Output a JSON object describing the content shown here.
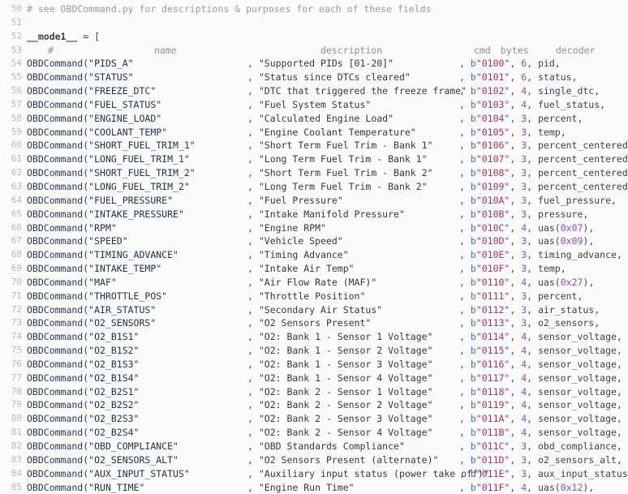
{
  "editor": {
    "background_color": "#fbfbfb",
    "gutter_color": "#b9b9b9",
    "first_line_number": 50,
    "last_line_number": 85,
    "accent_colors": {
      "byte_prefix": "#3b6fd4",
      "byte_string": "#a8345a",
      "number": "#8a4fbf",
      "identifier": "#3d4349",
      "function": "#2b3a55",
      "comment": "#9b9b9b"
    }
  },
  "lines": [
    {
      "number": "50",
      "kind": "comment",
      "comment": "# see OBDCommand.py for descriptions & purposes for each of these fields"
    },
    {
      "number": "51",
      "kind": "blank"
    },
    {
      "number": "52",
      "kind": "assignment",
      "var": "__mode1__",
      "op": "=",
      "bracket": "["
    },
    {
      "number": "53",
      "kind": "header",
      "hash": "#",
      "name": "name",
      "description": "description",
      "cmd": "cmd",
      "bytes": "bytes",
      "decoder": "decoder"
    },
    {
      "number": "54",
      "kind": "entry",
      "fn": "OBDCommand(",
      "name": "\"PIDS_A\"",
      "description": "\"Supported PIDs [01-20]\"",
      "byte_prefix": "b",
      "cmd": "\"0100\"",
      "bytes": "6",
      "decoder": "pid,"
    },
    {
      "number": "55",
      "kind": "entry",
      "fn": "OBDCommand(",
      "name": "\"STATUS\"",
      "description": "\"Status since DTCs cleared\"",
      "byte_prefix": "b",
      "cmd": "\"0101\"",
      "bytes": "6",
      "decoder": "status,"
    },
    {
      "number": "56",
      "kind": "entry",
      "fn": "OBDCommand(",
      "name": "\"FREEZE_DTC\"",
      "description": "\"DTC that triggered the freeze frame\"",
      "byte_prefix": "b",
      "cmd": "\"0102\"",
      "bytes": "4",
      "decoder": "single_dtc,"
    },
    {
      "number": "57",
      "kind": "entry",
      "fn": "OBDCommand(",
      "name": "\"FUEL_STATUS\"",
      "description": "\"Fuel System Status\"",
      "byte_prefix": "b",
      "cmd": "\"0103\"",
      "bytes": "4",
      "decoder": "fuel_status,"
    },
    {
      "number": "58",
      "kind": "entry",
      "fn": "OBDCommand(",
      "name": "\"ENGINE_LOAD\"",
      "description": "\"Calculated Engine Load\"",
      "byte_prefix": "b",
      "cmd": "\"0104\"",
      "bytes": "3",
      "decoder": "percent,"
    },
    {
      "number": "59",
      "kind": "entry",
      "fn": "OBDCommand(",
      "name": "\"COOLANT_TEMP\"",
      "description": "\"Engine Coolant Temperature\"",
      "byte_prefix": "b",
      "cmd": "\"0105\"",
      "bytes": "3",
      "decoder": "temp,"
    },
    {
      "number": "60",
      "kind": "entry",
      "fn": "OBDCommand(",
      "name": "\"SHORT_FUEL_TRIM_1\"",
      "description": "\"Short Term Fuel Trim - Bank 1\"",
      "byte_prefix": "b",
      "cmd": "\"0106\"",
      "bytes": "3",
      "decoder": "percent_centered,"
    },
    {
      "number": "61",
      "kind": "entry",
      "fn": "OBDCommand(",
      "name": "\"LONG_FUEL_TRIM_1\"",
      "description": "\"Long Term Fuel Trim - Bank 1\"",
      "byte_prefix": "b",
      "cmd": "\"0107\"",
      "bytes": "3",
      "decoder": "percent_centered,"
    },
    {
      "number": "62",
      "kind": "entry",
      "fn": "OBDCommand(",
      "name": "\"SHORT_FUEL_TRIM_2\"",
      "description": "\"Short Term Fuel Trim - Bank 2\"",
      "byte_prefix": "b",
      "cmd": "\"0108\"",
      "bytes": "3",
      "decoder": "percent_centered,"
    },
    {
      "number": "63",
      "kind": "entry",
      "fn": "OBDCommand(",
      "name": "\"LONG_FUEL_TRIM_2\"",
      "description": "\"Long Term Fuel Trim - Bank 2\"",
      "byte_prefix": "b",
      "cmd": "\"0109\"",
      "bytes": "3",
      "decoder": "percent_centered,"
    },
    {
      "number": "64",
      "kind": "entry",
      "fn": "OBDCommand(",
      "name": "\"FUEL_PRESSURE\"",
      "description": "\"Fuel Pressure\"",
      "byte_prefix": "b",
      "cmd": "\"010A\"",
      "bytes": "3",
      "decoder": "fuel_pressure,"
    },
    {
      "number": "65",
      "kind": "entry",
      "fn": "OBDCommand(",
      "name": "\"INTAKE_PRESSURE\"",
      "description": "\"Intake Manifold Pressure\"",
      "byte_prefix": "b",
      "cmd": "\"010B\"",
      "bytes": "3",
      "decoder": "pressure,"
    },
    {
      "number": "66",
      "kind": "entry",
      "fn": "OBDCommand(",
      "name": "\"RPM\"",
      "description": "\"Engine RPM\"",
      "byte_prefix": "b",
      "cmd": "\"010C\"",
      "bytes": "4",
      "decoder": "uas(0x07),",
      "decoder_hex": "0x07"
    },
    {
      "number": "67",
      "kind": "entry",
      "fn": "OBDCommand(",
      "name": "\"SPEED\"",
      "description": "\"Vehicle Speed\"",
      "byte_prefix": "b",
      "cmd": "\"010D\"",
      "bytes": "3",
      "decoder": "uas(0x09),",
      "decoder_hex": "0x09"
    },
    {
      "number": "68",
      "kind": "entry",
      "fn": "OBDCommand(",
      "name": "\"TIMING_ADVANCE\"",
      "description": "\"Timing Advance\"",
      "byte_prefix": "b",
      "cmd": "\"010E\"",
      "bytes": "3",
      "decoder": "timing_advance,"
    },
    {
      "number": "69",
      "kind": "entry",
      "fn": "OBDCommand(",
      "name": "\"INTAKE_TEMP\"",
      "description": "\"Intake Air Temp\"",
      "byte_prefix": "b",
      "cmd": "\"010F\"",
      "bytes": "3",
      "decoder": "temp,"
    },
    {
      "number": "70",
      "kind": "entry",
      "fn": "OBDCommand(",
      "name": "\"MAF\"",
      "description": "\"Air Flow Rate (MAF)\"",
      "byte_prefix": "b",
      "cmd": "\"0110\"",
      "bytes": "4",
      "decoder": "uas(0x27),",
      "decoder_hex": "0x27"
    },
    {
      "number": "71",
      "kind": "entry",
      "fn": "OBDCommand(",
      "name": "\"THROTTLE_POS\"",
      "description": "\"Throttle Position\"",
      "byte_prefix": "b",
      "cmd": "\"0111\"",
      "bytes": "3",
      "decoder": "percent,"
    },
    {
      "number": "72",
      "kind": "entry",
      "fn": "OBDCommand(",
      "name": "\"AIR_STATUS\"",
      "description": "\"Secondary Air Status\"",
      "byte_prefix": "b",
      "cmd": "\"0112\"",
      "bytes": "3",
      "decoder": "air_status,"
    },
    {
      "number": "73",
      "kind": "entry",
      "fn": "OBDCommand(",
      "name": "\"O2_SENSORS\"",
      "description": "\"O2 Sensors Present\"",
      "byte_prefix": "b",
      "cmd": "\"0113\"",
      "bytes": "3",
      "decoder": "o2_sensors,"
    },
    {
      "number": "74",
      "kind": "entry",
      "fn": "OBDCommand(",
      "name": "\"O2_B1S1\"",
      "description": "\"O2: Bank 1 - Sensor 1 Voltage\"",
      "byte_prefix": "b",
      "cmd": "\"0114\"",
      "bytes": "4",
      "decoder": "sensor_voltage,"
    },
    {
      "number": "75",
      "kind": "entry",
      "fn": "OBDCommand(",
      "name": "\"O2_B1S2\"",
      "description": "\"O2: Bank 1 - Sensor 2 Voltage\"",
      "byte_prefix": "b",
      "cmd": "\"0115\"",
      "bytes": "4",
      "decoder": "sensor_voltage,"
    },
    {
      "number": "76",
      "kind": "entry",
      "fn": "OBDCommand(",
      "name": "\"O2_B1S3\"",
      "description": "\"O2: Bank 1 - Sensor 3 Voltage\"",
      "byte_prefix": "b",
      "cmd": "\"0116\"",
      "bytes": "4",
      "decoder": "sensor_voltage,"
    },
    {
      "number": "77",
      "kind": "entry",
      "fn": "OBDCommand(",
      "name": "\"O2_B1S4\"",
      "description": "\"O2: Bank 1 - Sensor 4 Voltage\"",
      "byte_prefix": "b",
      "cmd": "\"0117\"",
      "bytes": "4",
      "decoder": "sensor_voltage,"
    },
    {
      "number": "78",
      "kind": "entry",
      "fn": "OBDCommand(",
      "name": "\"O2_B2S1\"",
      "description": "\"O2: Bank 2 - Sensor 1 Voltage\"",
      "byte_prefix": "b",
      "cmd": "\"0118\"",
      "bytes": "4",
      "decoder": "sensor_voltage,"
    },
    {
      "number": "79",
      "kind": "entry",
      "fn": "OBDCommand(",
      "name": "\"O2_B2S2\"",
      "description": "\"O2: Bank 2 - Sensor 2 Voltage\"",
      "byte_prefix": "b",
      "cmd": "\"0119\"",
      "bytes": "4",
      "decoder": "sensor_voltage,"
    },
    {
      "number": "80",
      "kind": "entry",
      "fn": "OBDCommand(",
      "name": "\"O2_B2S3\"",
      "description": "\"O2: Bank 2 - Sensor 3 Voltage\"",
      "byte_prefix": "b",
      "cmd": "\"011A\"",
      "bytes": "4",
      "decoder": "sensor_voltage,"
    },
    {
      "number": "81",
      "kind": "entry",
      "fn": "OBDCommand(",
      "name": "\"O2_B2S4\"",
      "description": "\"O2: Bank 2 - Sensor 4 Voltage\"",
      "byte_prefix": "b",
      "cmd": "\"011B\"",
      "bytes": "4",
      "decoder": "sensor_voltage,"
    },
    {
      "number": "82",
      "kind": "entry",
      "fn": "OBDCommand(",
      "name": "\"OBD_COMPLIANCE\"",
      "description": "\"OBD Standards Compliance\"",
      "byte_prefix": "b",
      "cmd": "\"011C\"",
      "bytes": "3",
      "decoder": "obd_compliance,"
    },
    {
      "number": "83",
      "kind": "entry",
      "fn": "OBDCommand(",
      "name": "\"O2_SENSORS_ALT\"",
      "description": "\"O2 Sensors Present (alternate)\"",
      "byte_prefix": "b",
      "cmd": "\"011D\"",
      "bytes": "3",
      "decoder": "o2_sensors_alt,"
    },
    {
      "number": "84",
      "kind": "entry",
      "fn": "OBDCommand(",
      "name": "\"AUX_INPUT_STATUS\"",
      "description": "\"Auxiliary input status (power take off)\"",
      "byte_prefix": "b",
      "cmd": "\"011E\"",
      "bytes": "3",
      "decoder": "aux_input_status,"
    },
    {
      "number": "85",
      "kind": "entry",
      "fn": "OBDCommand(",
      "name": "\"RUN_TIME\"",
      "description": "\"Engine Run Time\"",
      "byte_prefix": "b",
      "cmd": "\"011F\"",
      "bytes": "4",
      "decoder": "uas(0x12),",
      "decoder_hex": "0x12"
    }
  ]
}
